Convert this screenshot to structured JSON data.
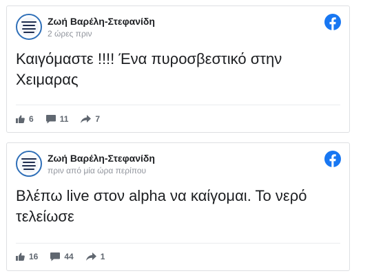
{
  "posts": [
    {
      "author": "Ζωή Βαρέλη-Στεφανίδη",
      "time": "2 ώρες πριν",
      "text": "Καιγόμαστε !!!! Ένα πυροσβεστικό στην Χειμαρας",
      "likes": "6",
      "comments": "11",
      "shares": "7"
    },
    {
      "author": "Ζωή Βαρέλη-Στεφανίδη",
      "time": "πριν από μία ώρα περίπου",
      "text": "Βλέπω live στον alpha να καίγομαι. Το νερό τελείωσε",
      "likes": "16",
      "comments": "44",
      "shares": "1"
    }
  ],
  "icons": {
    "platform": "facebook-icon",
    "like": "thumbs-up-icon",
    "comment": "comment-icon",
    "share": "share-arrow-icon"
  },
  "colors": {
    "facebook_blue": "#1877f2",
    "stat_gray": "#606770",
    "avatar_ring": "#2f6fb8"
  }
}
